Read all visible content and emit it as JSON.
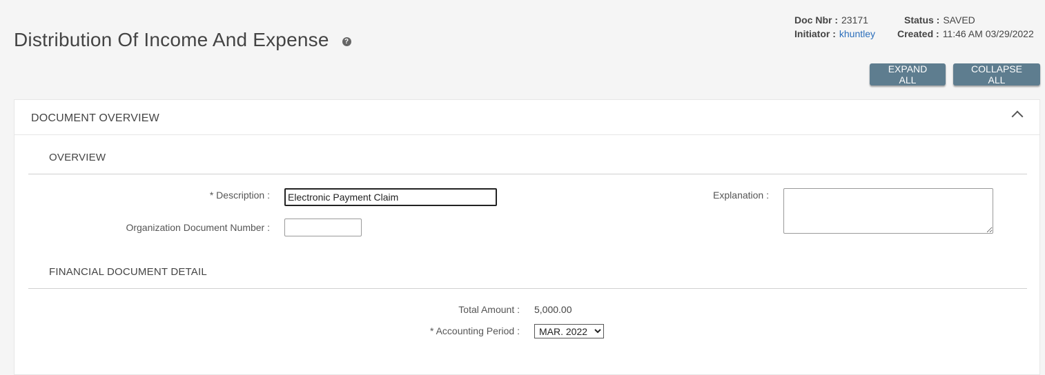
{
  "header": {
    "title": "Distribution Of Income And Expense",
    "help_glyph": "?"
  },
  "doc_info": {
    "doc_nbr_label": "Doc Nbr :",
    "doc_nbr_value": "23171",
    "status_label": "Status :",
    "status_value": "SAVED",
    "initiator_label": "Initiator :",
    "initiator_value": "khuntley",
    "created_label": "Created :",
    "created_value": "11:46 AM 03/29/2022"
  },
  "toolbar": {
    "expand_all": "EXPAND ALL",
    "collapse_all": "COLLAPSE ALL"
  },
  "panel": {
    "title": "DOCUMENT OVERVIEW",
    "overview": {
      "title": "OVERVIEW",
      "description_label": "* Description :",
      "description_value": "Electronic Payment Claim",
      "org_doc_number_label": "Organization Document Number :",
      "org_doc_number_value": "",
      "explanation_label": "Explanation :",
      "explanation_value": ""
    },
    "financial": {
      "title": "FINANCIAL DOCUMENT DETAIL",
      "total_amount_label": "Total Amount :",
      "total_amount_value": "5,000.00",
      "accounting_period_label": "* Accounting Period :",
      "accounting_period_selected": "MAR. 2022"
    }
  },
  "colors": {
    "button_bg": "#5e7d8f",
    "link": "#2a6ebb"
  }
}
